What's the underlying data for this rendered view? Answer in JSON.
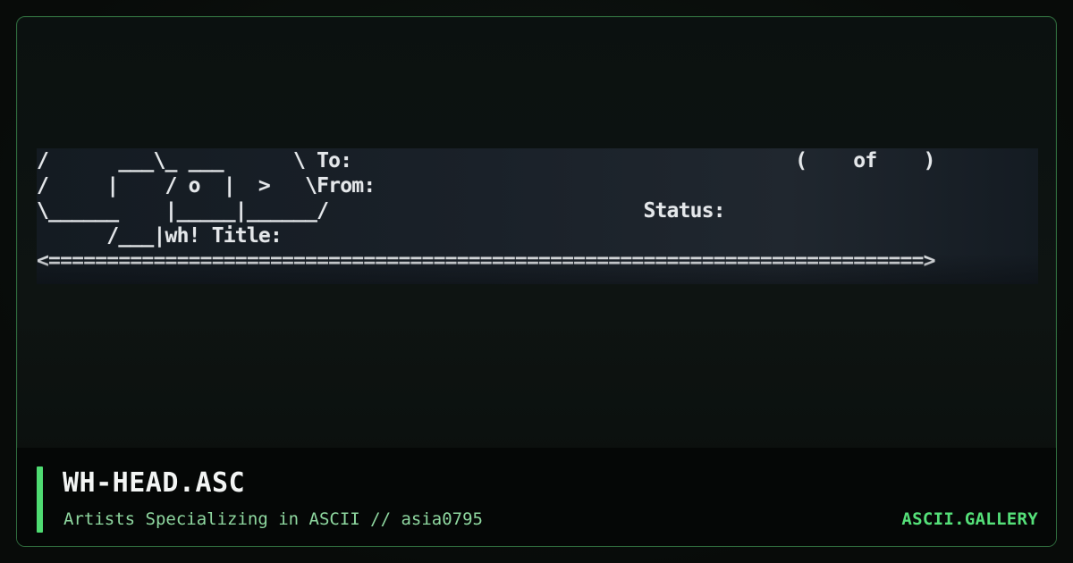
{
  "artwork": {
    "ascii_lines": [
      "/      ___\\_ ___      \\ To:                                      (    of    )",
      "/     |    / o  |  >   \\From:",
      "\\______    |_____|______/                           Status:",
      "      /___|wh! Title:",
      "<===========================================================================>"
    ]
  },
  "caption": {
    "title": "WH-HEAD.ASC",
    "subtitle": "Artists Specializing in ASCII // asia0795",
    "site": "ASCII.GALLERY"
  },
  "colors": {
    "accent": "#4fdc72",
    "frame_border": "#2f6b3d",
    "subtitle": "#8fd8a0",
    "site": "#55e079"
  }
}
